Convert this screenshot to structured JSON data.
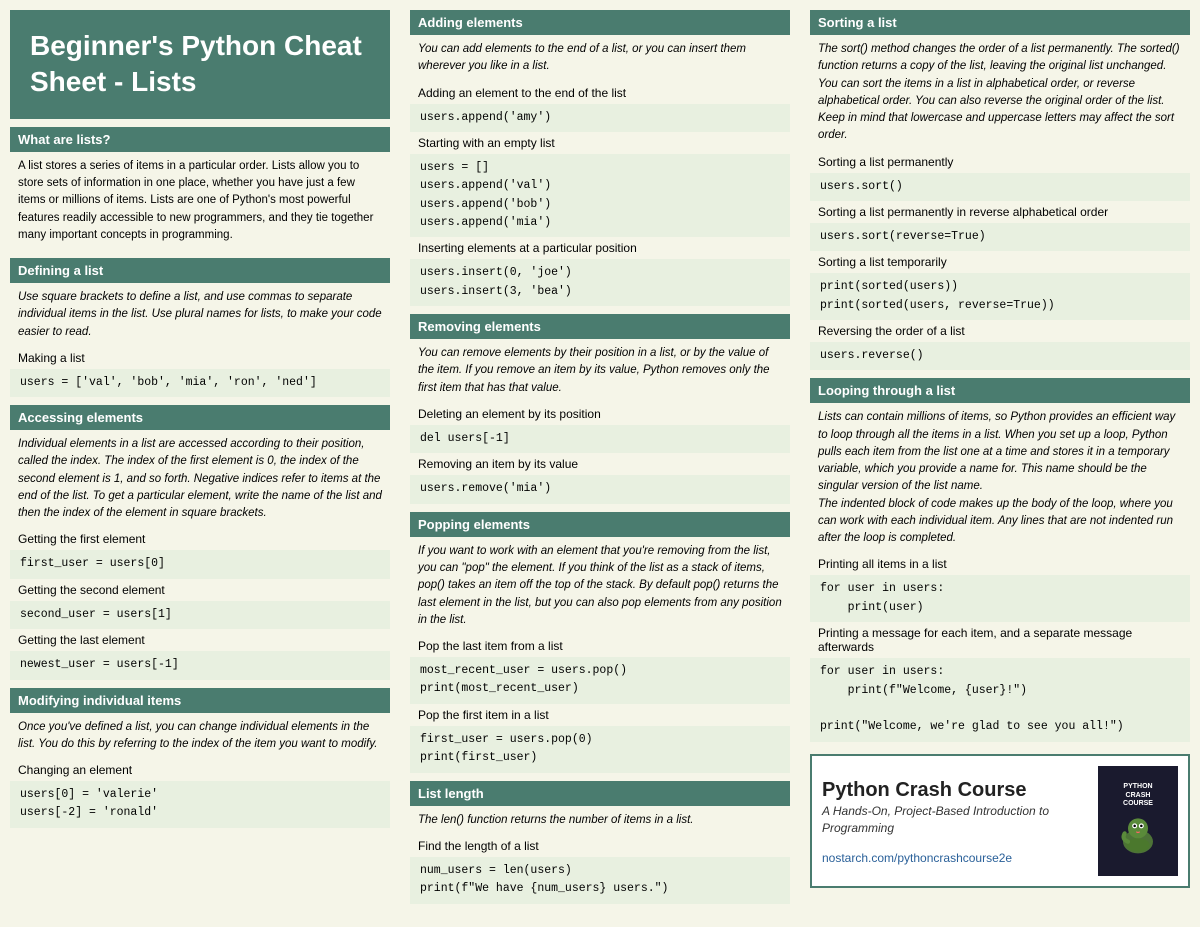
{
  "header": {
    "title": "Beginner's Python Cheat Sheet - Lists"
  },
  "col1": {
    "sections": [
      {
        "id": "what-are-lists",
        "header": "What are lists?",
        "body": "A list stores a series of items in a particular order. Lists allow you to store sets of information in one place, whether you have just a few items or millions of items. Lists are one of Python's most powerful features readily accessible to new programmers, and they tie together many important concepts in programming."
      },
      {
        "id": "defining-a-list",
        "header": "Defining a list",
        "body": "Use square brackets to define a list, and use commas to separate individual items in the list. Use plural names for lists, to make your code easier to read.",
        "items": [
          {
            "label": "Making a list",
            "code": "users = ['val', 'bob', 'mia', 'ron', 'ned']"
          }
        ]
      },
      {
        "id": "accessing-elements",
        "header": "Accessing elements",
        "body": "Individual elements in a list are accessed according to their position, called the index. The index of the first element is 0, the index of the second element is 1, and so forth. Negative indices refer to items at the end of the list. To get a particular element, write the name of the list and then the index of the element in square brackets.",
        "items": [
          {
            "label": "Getting the first element",
            "code": "first_user = users[0]"
          },
          {
            "label": "Getting the second element",
            "code": "second_user = users[1]"
          },
          {
            "label": "Getting the last element",
            "code": "newest_user = users[-1]"
          }
        ]
      },
      {
        "id": "modifying-items",
        "header": "Modifying individual items",
        "body": "Once you've defined a list, you can change individual elements in the list. You do this by referring to the index of the item you want to modify.",
        "items": [
          {
            "label": "Changing an element",
            "code": "users[0] = 'valerie'\nusers[-2] = 'ronald'"
          }
        ]
      }
    ]
  },
  "col2": {
    "sections": [
      {
        "id": "adding-elements",
        "header": "Adding elements",
        "body": "You can add elements to the end of a list, or you can insert them wherever you like in a list.",
        "items": [
          {
            "label": "Adding an element to the end of the list",
            "code": "users.append('amy')"
          },
          {
            "label": "Starting with an empty list",
            "code": "users = []\nusers.append('val')\nusers.append('bob')\nusers.append('mia')"
          },
          {
            "label": "Inserting elements at a particular position",
            "code": "users.insert(0, 'joe')\nusers.insert(3, 'bea')"
          }
        ]
      },
      {
        "id": "removing-elements",
        "header": "Removing elements",
        "body": "You can remove elements by their position in a list, or by the value of the item. If you remove an item by its value, Python removes only the first item that has that value.",
        "items": [
          {
            "label": "Deleting an element by its position",
            "code": "del users[-1]"
          },
          {
            "label": "Removing an item by its value",
            "code": "users.remove('mia')"
          }
        ]
      },
      {
        "id": "popping-elements",
        "header": "Popping elements",
        "body": "If you want to work with an element that you're removing from the list, you can \"pop\" the element. If you think of the list as a stack of items, pop() takes an item off the top of the stack. By default pop() returns the last element in the list, but you can also pop elements from any position in the list.",
        "items": [
          {
            "label": "Pop the last item from a list",
            "code": "most_recent_user = users.pop()\nprint(most_recent_user)"
          },
          {
            "label": "Pop the first item in a list",
            "code": "first_user = users.pop(0)\nprint(first_user)"
          }
        ]
      },
      {
        "id": "list-length",
        "header": "List length",
        "body": "The len() function returns the number of items in a list.",
        "items": [
          {
            "label": "Find the length of a list",
            "code": "num_users = len(users)\nprint(f\"We have {num_users} users.\")"
          }
        ]
      }
    ]
  },
  "col3": {
    "sections": [
      {
        "id": "sorting-a-list",
        "header": "Sorting a list",
        "body": "The sort() method changes the order of a list permanently. The sorted() function returns a copy of the list, leaving the original list unchanged. You can sort the items in a list in alphabetical order, or reverse alphabetical order. You can also reverse the original order of the list. Keep in mind that lowercase and uppercase letters may affect the sort order.",
        "items": [
          {
            "label": "Sorting a list permanently",
            "code": "users.sort()"
          },
          {
            "label": "Sorting a list permanently in reverse alphabetical order",
            "code": "users.sort(reverse=True)"
          },
          {
            "label": "Sorting a list temporarily",
            "code": "print(sorted(users))\nprint(sorted(users, reverse=True))"
          },
          {
            "label": "Reversing the order of a list",
            "code": "users.reverse()"
          }
        ]
      },
      {
        "id": "looping",
        "header": "Looping through a list",
        "body": "Lists can contain millions of items, so Python provides an efficient way to loop through all the items in a list. When you set up a loop, Python pulls each item from the list one at a time and stores it in a temporary variable, which you provide a name for. This name should be the singular version of the list name.\n    The indented block of code makes up the body of the loop, where you can work with each individual item. Any lines that are not indented run after the loop is completed.",
        "items": [
          {
            "label": "Printing all items in a list",
            "code": "for user in users:\n    print(user)"
          },
          {
            "label": "Printing a message for each item, and a separate message afterwards",
            "code": "for user in users:\n    print(f\"Welcome, {user}!\")\n\nprint(\"Welcome, we're glad to see you all!\")"
          }
        ]
      }
    ],
    "book": {
      "title": "Python Crash Course",
      "subtitle": "A Hands-On, Project-Based Introduction to Programming",
      "url": "nostarch.com/pythoncrashcourse2e"
    }
  }
}
